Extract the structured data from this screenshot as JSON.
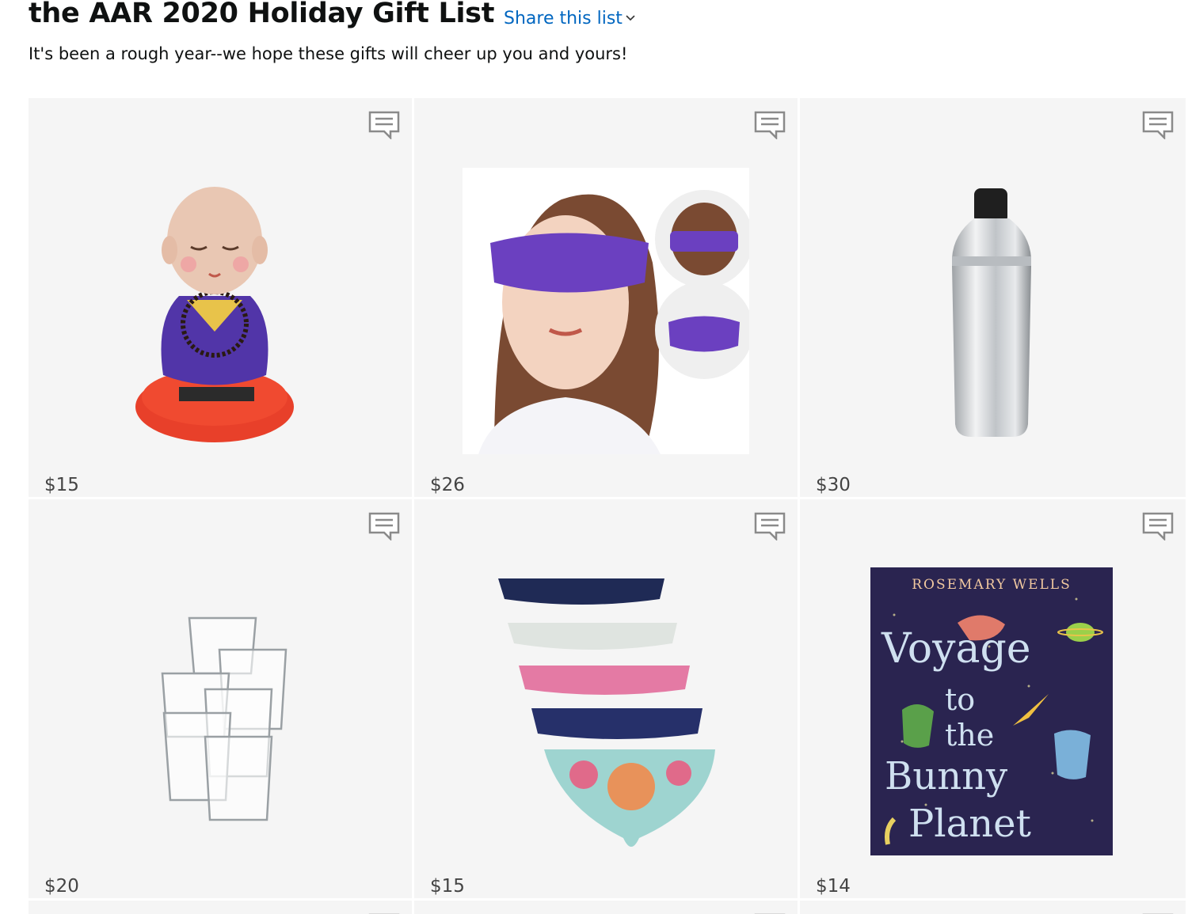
{
  "list": {
    "title": "the AAR 2020 Holiday Gift List",
    "share_label": "Share this list",
    "description": "It's been a rough year--we hope these gifts will cheer up you and yours!"
  },
  "items": [
    {
      "price": "$15",
      "image": "solar-monk-figurine",
      "comment_icon": "comment-icon"
    },
    {
      "price": "$26",
      "image": "purple-sleep-mask",
      "comment_icon": "comment-icon"
    },
    {
      "price": "$30",
      "image": "stainless-cocktail-shaker",
      "comment_icon": "comment-icon"
    },
    {
      "price": "$20",
      "image": "glass-tumblers-set",
      "comment_icon": "comment-icon"
    },
    {
      "price": "$15",
      "image": "printed-underwear-pack",
      "comment_icon": "comment-icon"
    },
    {
      "price": "$14",
      "image": "book-voyage-to-the-bunny-planet",
      "comment_icon": "comment-icon"
    }
  ],
  "book_cover": {
    "author": "ROSEMARY WELLS",
    "title_line1": "Voyage",
    "title_line2": "to",
    "title_line3": "the",
    "title_line4": "Bunny",
    "title_line5": "Planet"
  },
  "colors": {
    "link": "#0066c0",
    "tile_bg": "#f5f5f5",
    "price_text": "#444444",
    "mask_purple": "#6b40c0",
    "book_bg": "#2a2450"
  }
}
